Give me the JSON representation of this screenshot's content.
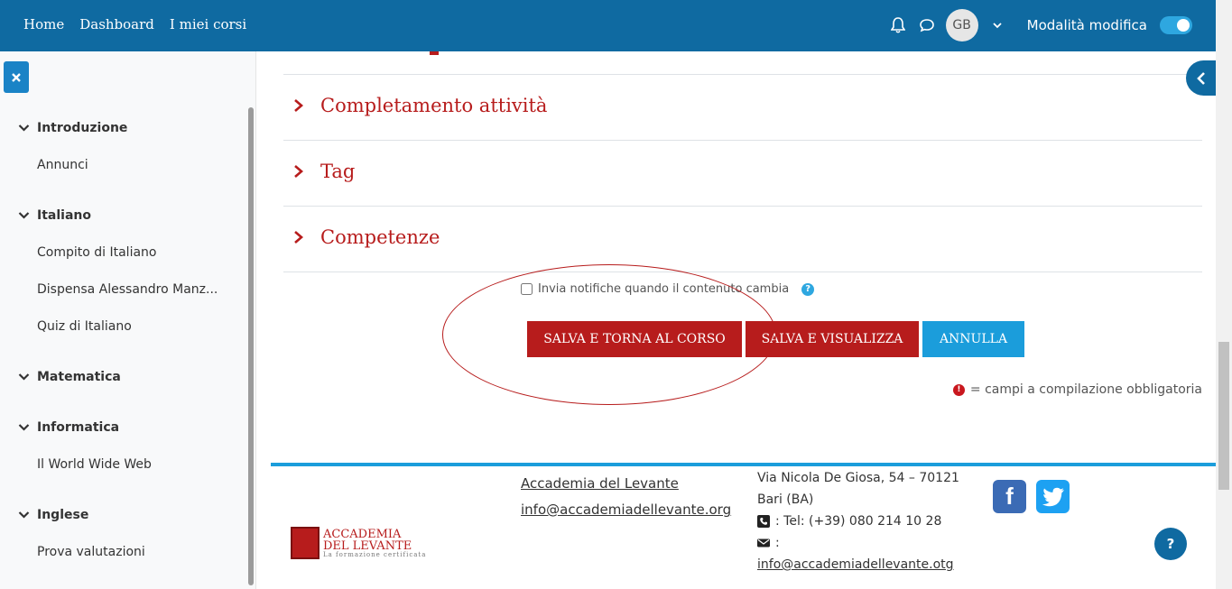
{
  "nav": {
    "links": [
      "Home",
      "Dashboard",
      "I miei corsi"
    ],
    "avatar_initials": "GB",
    "edit_mode_label": "Modalità modifica",
    "edit_mode_on": true,
    "bar_color": "#0f6aa1"
  },
  "drawer": {
    "sections": [
      {
        "title": "Introduzione",
        "items": [
          "Annunci"
        ]
      },
      {
        "title": "Italiano",
        "items": [
          "Compito di Italiano",
          "Dispensa Alessandro Manz...",
          "Quiz di Italiano"
        ]
      },
      {
        "title": "Matematica",
        "items": []
      },
      {
        "title": "Informatica",
        "items": [
          "Il World Wide Web"
        ]
      },
      {
        "title": "Inglese",
        "items": [
          "Prova valutazioni"
        ]
      }
    ]
  },
  "form": {
    "sections": [
      "Completamento attività",
      "Tag",
      "Competenze"
    ],
    "notify_label": "Invia notifiche quando il contenuto cambia",
    "notify_checked": false,
    "buttons": {
      "save_return": "SALVA E TORNA AL CORSO",
      "save_view": "SALVA E VISUALIZZA",
      "cancel": "ANNULLA"
    },
    "required_note": "= campi a compilazione obbligatoria"
  },
  "footer": {
    "logo": {
      "line1": "ACCADEMIA",
      "line2": "DEL LEVANTE",
      "tagline": "La formazione certificata"
    },
    "org_name": "Accademia del Levante",
    "email1": "info@accademiadellevante.org",
    "address_line1": "Via Nicola De Giosa, 54 – 70121",
    "address_line2": "Bari (BA)",
    "phone": ": Tel: (+39) 080 214 10 28",
    "email_label": ":",
    "email2": "info@accademiadellevante.otg"
  },
  "colors": {
    "accent_red": "#b71c1c",
    "accent_blue": "#1b9ddb"
  },
  "icons": [
    "bell-icon",
    "chat-icon",
    "chevron-down-icon",
    "close-icon",
    "chevron-left-icon",
    "question-icon",
    "phone-icon",
    "envelope-icon",
    "facebook-icon",
    "twitter-icon"
  ]
}
